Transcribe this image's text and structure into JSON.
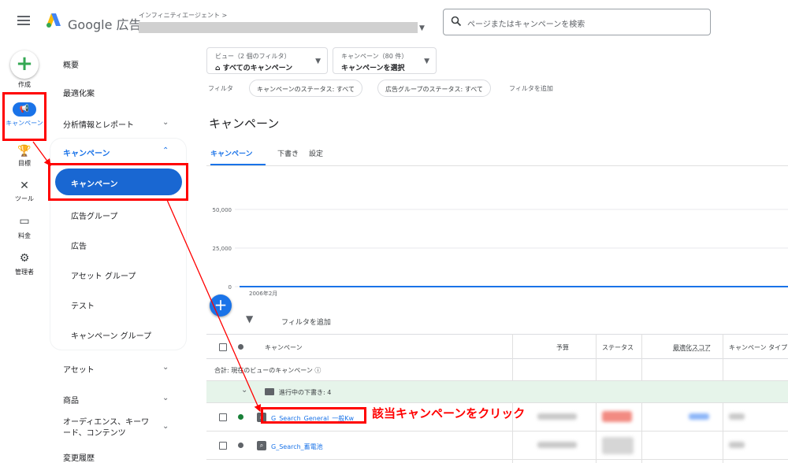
{
  "header": {
    "brand": "Google 広告",
    "account_small": "インフィニティエージェント >",
    "search_placeholder": "ページまたはキャンペーンを検索"
  },
  "rail": {
    "create": "作成",
    "campaigns": "キャンペーン",
    "goals": "目標",
    "tools": "ツール",
    "billing": "料金",
    "admin": "管理者"
  },
  "nav": {
    "overview": "概要",
    "recommendations": "最適化案",
    "insights": "分析情報とレポート",
    "campaigns_section": "キャンペーン",
    "campaigns_sub": [
      "キャンペーン",
      "広告グループ",
      "広告",
      "アセット グループ",
      "テスト",
      "キャンペーン グループ"
    ],
    "assets": "アセット",
    "products": "商品",
    "audiences": "オーディエンス、キーワード、コンテンツ",
    "change_history": "変更履歴"
  },
  "view": {
    "view_small": "ビュー（2 個のフィルタ）",
    "view_main": "すべてのキャンペーン",
    "camp_small": "キャンペーン（80 件）",
    "camp_main": "キャンペーンを選択"
  },
  "filters": {
    "label": "フィルタ",
    "chips": [
      "キャンペーンのステータス: すべて",
      "広告グループのステータス: すべて"
    ],
    "add": "フィルタを追加"
  },
  "page": {
    "title": "キャンペーン",
    "tabs": [
      "キャンペーン",
      "下書き",
      "設定"
    ]
  },
  "chart_data": {
    "type": "line",
    "y_ticks": [
      "50,000",
      "25,000",
      "0"
    ],
    "x_ticks": [
      "2006年2月"
    ],
    "ylim": [
      0,
      50000
    ],
    "series": [
      {
        "values": [
          0,
          0,
          0,
          0
        ]
      }
    ]
  },
  "table": {
    "filter_add": "フィルタを追加",
    "headers": {
      "campaign": "キャンペーン",
      "budget": "予算",
      "status": "ステータス",
      "opt_score": "最適化スコア",
      "type": "キャンペーン タイプ"
    },
    "total_label": "合計: 現在のビューのキャンペーン",
    "draft_label": "進行中の下書き: 4",
    "rows": [
      {
        "name": "G_Search_General_一般Kw"
      },
      {
        "name": "G_Search_蓄電池"
      }
    ]
  },
  "annotation": {
    "callout": "該当キャンペーンをクリック"
  },
  "colors": {
    "accent": "#1a73e8",
    "highlight": "#ff0000",
    "draft_bg": "#e6f4ea"
  }
}
